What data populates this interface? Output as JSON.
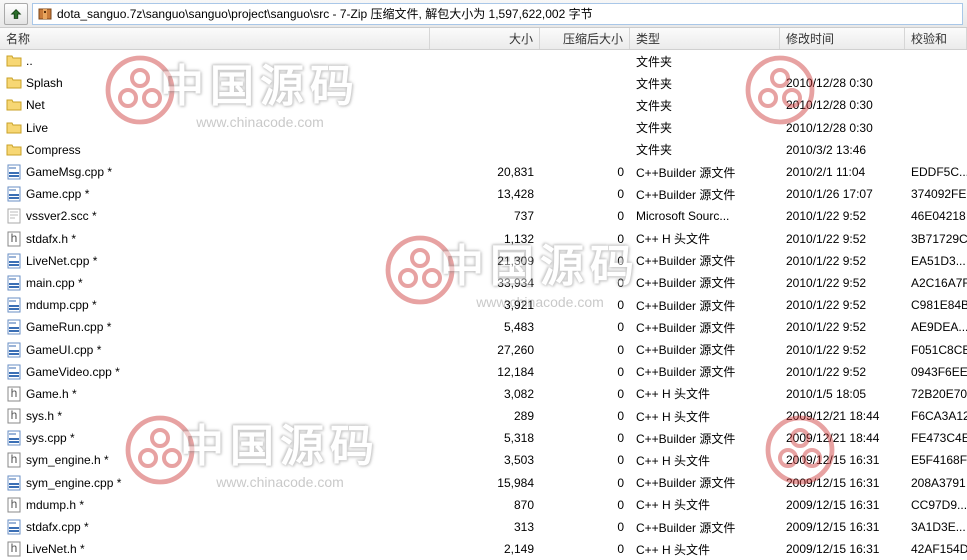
{
  "toolbar": {
    "up_tooltip": "上级目录",
    "path": "dota_sanguo.7z\\sanguo\\sanguo\\project\\sanguo\\src - 7-Zip 压缩文件, 解包大小为 1,597,622,002 字节"
  },
  "columns": {
    "name": "名称",
    "size": "大小",
    "packed": "压缩后大小",
    "type": "类型",
    "date": "修改时间",
    "crc": "校验和"
  },
  "rows": [
    {
      "icon": "folder",
      "name": "..",
      "size": "",
      "packed": "",
      "type": "文件夹",
      "date": "",
      "crc": ""
    },
    {
      "icon": "folder",
      "name": "Splash",
      "size": "",
      "packed": "",
      "type": "文件夹",
      "date": "2010/12/28 0:30",
      "crc": ""
    },
    {
      "icon": "folder",
      "name": "Net",
      "size": "",
      "packed": "",
      "type": "文件夹",
      "date": "2010/12/28 0:30",
      "crc": ""
    },
    {
      "icon": "folder",
      "name": "Live",
      "size": "",
      "packed": "",
      "type": "文件夹",
      "date": "2010/12/28 0:30",
      "crc": ""
    },
    {
      "icon": "folder",
      "name": "Compress",
      "size": "",
      "packed": "",
      "type": "文件夹",
      "date": "2010/3/2 13:46",
      "crc": ""
    },
    {
      "icon": "cpp",
      "name": "GameMsg.cpp *",
      "size": "20,831",
      "packed": "0",
      "type": "C++Builder 源文件",
      "date": "2010/2/1 11:04",
      "crc": "EDDF5C..."
    },
    {
      "icon": "cpp",
      "name": "Game.cpp *",
      "size": "13,428",
      "packed": "0",
      "type": "C++Builder 源文件",
      "date": "2010/1/26 17:07",
      "crc": "374092FE"
    },
    {
      "icon": "file",
      "name": "vssver2.scc *",
      "size": "737",
      "packed": "0",
      "type": "Microsoft Sourc...",
      "date": "2010/1/22 9:52",
      "crc": "46E04218"
    },
    {
      "icon": "h",
      "name": "stdafx.h *",
      "size": "1,132",
      "packed": "0",
      "type": "C++ H 头文件",
      "date": "2010/1/22 9:52",
      "crc": "3B71729C"
    },
    {
      "icon": "cpp",
      "name": "LiveNet.cpp *",
      "size": "21,309",
      "packed": "0",
      "type": "C++Builder 源文件",
      "date": "2010/1/22 9:52",
      "crc": "EA51D3..."
    },
    {
      "icon": "cpp",
      "name": "main.cpp *",
      "size": "33,934",
      "packed": "0",
      "type": "C++Builder 源文件",
      "date": "2010/1/22 9:52",
      "crc": "A2C16A7F"
    },
    {
      "icon": "cpp",
      "name": "mdump.cpp *",
      "size": "3,921",
      "packed": "0",
      "type": "C++Builder 源文件",
      "date": "2010/1/22 9:52",
      "crc": "C981E84B"
    },
    {
      "icon": "cpp",
      "name": "GameRun.cpp *",
      "size": "5,483",
      "packed": "0",
      "type": "C++Builder 源文件",
      "date": "2010/1/22 9:52",
      "crc": "AE9DEA..."
    },
    {
      "icon": "cpp",
      "name": "GameUI.cpp *",
      "size": "27,260",
      "packed": "0",
      "type": "C++Builder 源文件",
      "date": "2010/1/22 9:52",
      "crc": "F051C8CB"
    },
    {
      "icon": "cpp",
      "name": "GameVideo.cpp *",
      "size": "12,184",
      "packed": "0",
      "type": "C++Builder 源文件",
      "date": "2010/1/22 9:52",
      "crc": "0943F6EE"
    },
    {
      "icon": "h",
      "name": "Game.h *",
      "size": "3,082",
      "packed": "0",
      "type": "C++ H 头文件",
      "date": "2010/1/5 18:05",
      "crc": "72B20E70"
    },
    {
      "icon": "h",
      "name": "sys.h *",
      "size": "289",
      "packed": "0",
      "type": "C++ H 头文件",
      "date": "2009/12/21 18:44",
      "crc": "F6CA3A12"
    },
    {
      "icon": "cpp",
      "name": "sys.cpp *",
      "size": "5,318",
      "packed": "0",
      "type": "C++Builder 源文件",
      "date": "2009/12/21 18:44",
      "crc": "FE473C4E"
    },
    {
      "icon": "h",
      "name": "sym_engine.h *",
      "size": "3,503",
      "packed": "0",
      "type": "C++ H 头文件",
      "date": "2009/12/15 16:31",
      "crc": "E5F4168F"
    },
    {
      "icon": "cpp",
      "name": "sym_engine.cpp *",
      "size": "15,984",
      "packed": "0",
      "type": "C++Builder 源文件",
      "date": "2009/12/15 16:31",
      "crc": "208A3791"
    },
    {
      "icon": "h",
      "name": "mdump.h *",
      "size": "870",
      "packed": "0",
      "type": "C++ H 头文件",
      "date": "2009/12/15 16:31",
      "crc": "CC97D9..."
    },
    {
      "icon": "cpp",
      "name": "stdafx.cpp *",
      "size": "313",
      "packed": "0",
      "type": "C++Builder 源文件",
      "date": "2009/12/15 16:31",
      "crc": "3A1D3E..."
    },
    {
      "icon": "h",
      "name": "LiveNet.h *",
      "size": "2,149",
      "packed": "0",
      "type": "C++ H 头文件",
      "date": "2009/12/15 16:31",
      "crc": "42AF154D"
    }
  ],
  "watermark": {
    "text": "中国源码",
    "url": "www.chinacode.com"
  }
}
